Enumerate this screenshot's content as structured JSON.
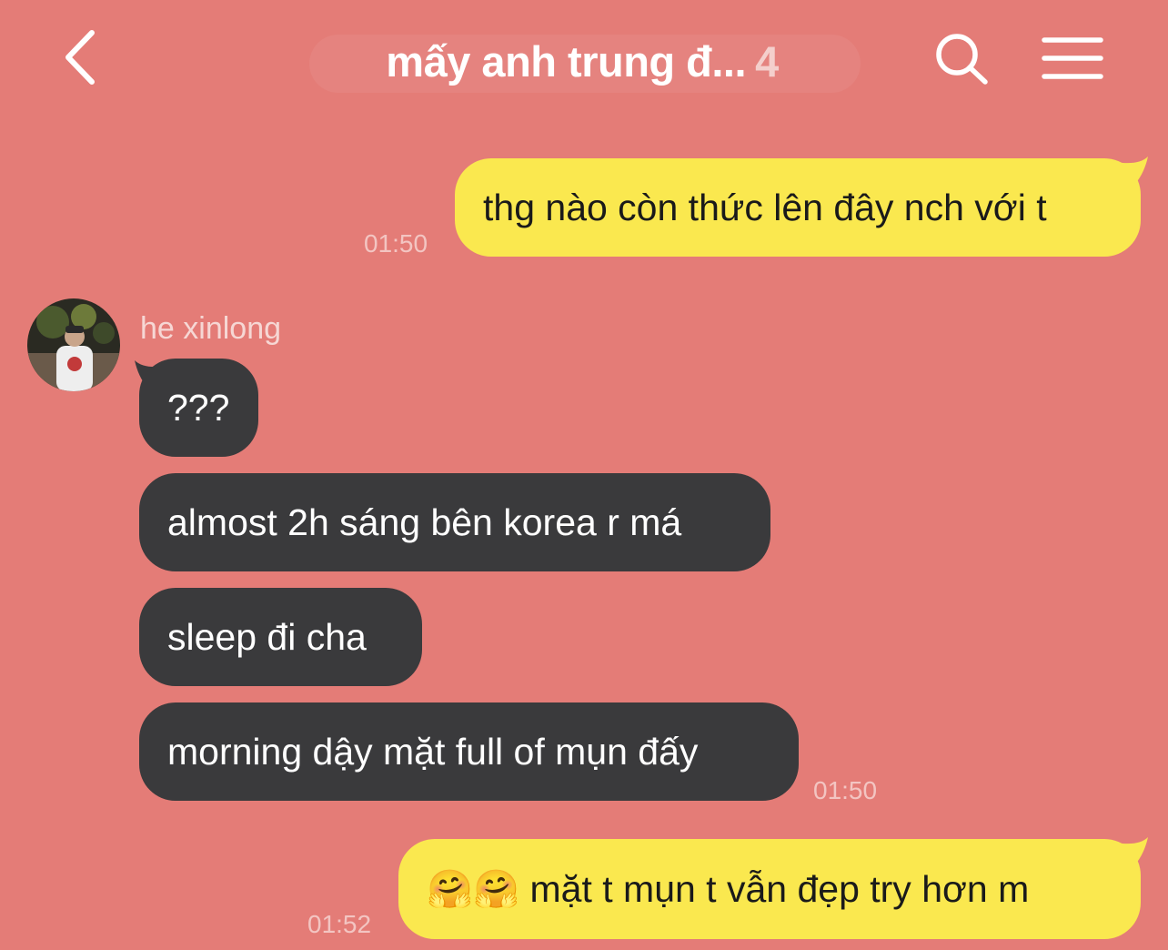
{
  "header": {
    "title": "mấy anh trung đ...",
    "member_count": "4"
  },
  "icons": {
    "back": "chevron-left-icon",
    "search": "search-icon",
    "menu": "hamburger-menu-icon"
  },
  "colors": {
    "background": "#e47c77",
    "outgoing_bubble": "#fae84f",
    "incoming_bubble": "#3a3a3c"
  },
  "messages": {
    "m1": {
      "text": "thg nào còn thức lên đây nch với t",
      "time": "01:50"
    },
    "m2": {
      "sender": "he xinlong",
      "lines": [
        "???",
        "almost 2h sáng bên korea r má",
        "sleep đi cha",
        "morning dậy mặt full of mụn đấy"
      ],
      "time": "01:50"
    },
    "m3": {
      "emoji": "🤗🤗",
      "text": "mặt t mụn t vẫn đẹp try hơn m",
      "time": "01:52"
    }
  }
}
